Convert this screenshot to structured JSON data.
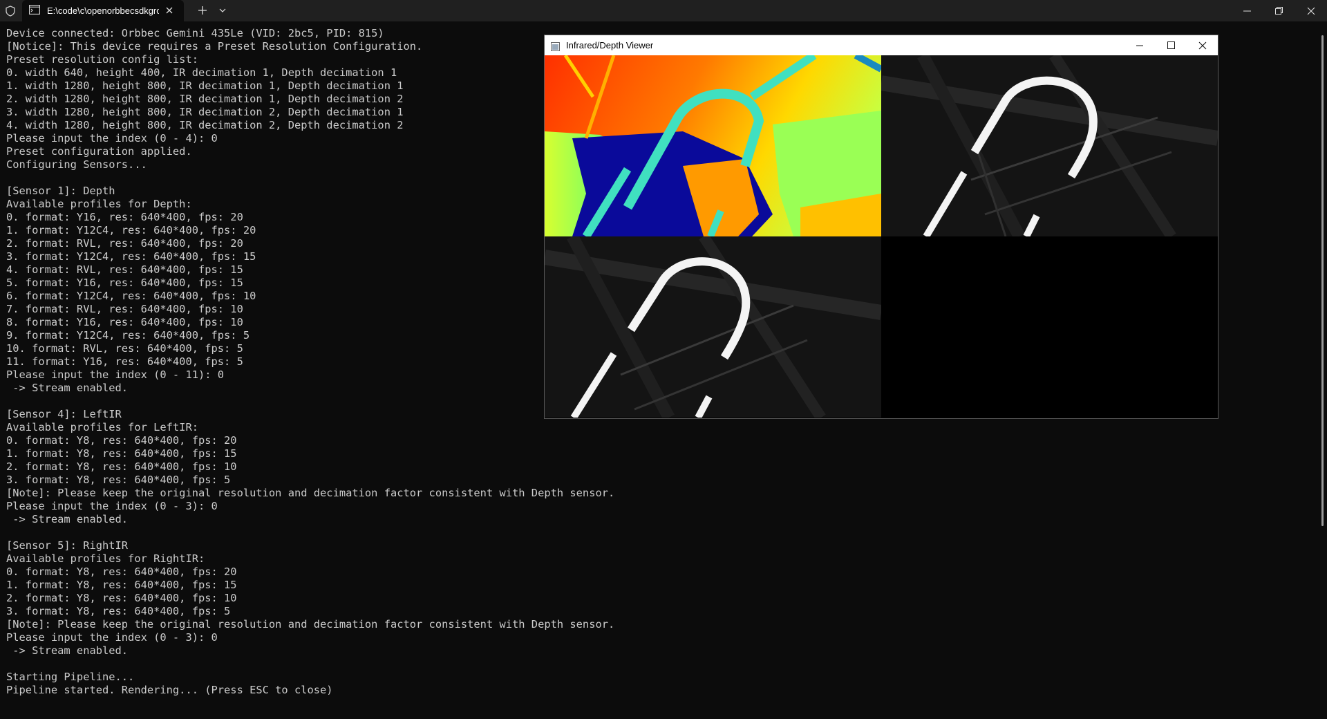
{
  "tabbar": {
    "tab_title": "E:\\code\\c\\openorbbecsdkgrou"
  },
  "terminal": {
    "lines": [
      "Device connected: Orbbec Gemini 435Le (VID: 2bc5, PID: 815)",
      "[Notice]: This device requires a Preset Resolution Configuration.",
      "Preset resolution config list:",
      "0. width 640, height 400, IR decimation 1, Depth decimation 1",
      "1. width 1280, height 800, IR decimation 1, Depth decimation 1",
      "2. width 1280, height 800, IR decimation 1, Depth decimation 2",
      "3. width 1280, height 800, IR decimation 2, Depth decimation 1",
      "4. width 1280, height 800, IR decimation 2, Depth decimation 2",
      "Please input the index (0 - 4): 0",
      "Preset configuration applied.",
      "Configuring Sensors...",
      "",
      "[Sensor 1]: Depth",
      "Available profiles for Depth:",
      "0. format: Y16, res: 640*400, fps: 20",
      "1. format: Y12C4, res: 640*400, fps: 20",
      "2. format: RVL, res: 640*400, fps: 20",
      "3. format: Y12C4, res: 640*400, fps: 15",
      "4. format: RVL, res: 640*400, fps: 15",
      "5. format: Y16, res: 640*400, fps: 15",
      "6. format: Y12C4, res: 640*400, fps: 10",
      "7. format: RVL, res: 640*400, fps: 10",
      "8. format: Y16, res: 640*400, fps: 10",
      "9. format: Y12C4, res: 640*400, fps: 5",
      "10. format: RVL, res: 640*400, fps: 5",
      "11. format: Y16, res: 640*400, fps: 5",
      "Please input the index (0 - 11): 0",
      " -> Stream enabled.",
      "",
      "[Sensor 4]: LeftIR",
      "Available profiles for LeftIR:",
      "0. format: Y8, res: 640*400, fps: 20",
      "1. format: Y8, res: 640*400, fps: 15",
      "2. format: Y8, res: 640*400, fps: 10",
      "3. format: Y8, res: 640*400, fps: 5",
      "[Note]: Please keep the original resolution and decimation factor consistent with Depth sensor.",
      "Please input the index (0 - 3): 0",
      " -> Stream enabled.",
      "",
      "[Sensor 5]: RightIR",
      "Available profiles for RightIR:",
      "0. format: Y8, res: 640*400, fps: 20",
      "1. format: Y8, res: 640*400, fps: 15",
      "2. format: Y8, res: 640*400, fps: 10",
      "3. format: Y8, res: 640*400, fps: 5",
      "[Note]: Please keep the original resolution and decimation factor consistent with Depth sensor.",
      "Please input the index (0 - 3): 0",
      " -> Stream enabled.",
      "",
      "Starting Pipeline...",
      "Pipeline started. Rendering... (Press ESC to close)"
    ]
  },
  "viewer": {
    "title": "Infrared/Depth Viewer"
  },
  "colors": {
    "terminal_bg": "#0c0c0c",
    "terminal_fg": "#cccccc",
    "titlebar_bg": "#202020"
  }
}
